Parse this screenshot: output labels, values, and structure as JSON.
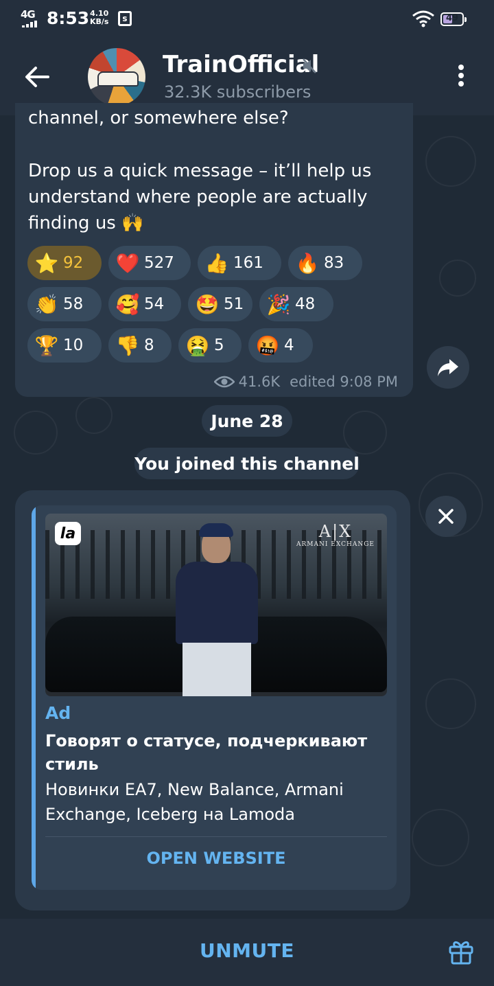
{
  "status_bar": {
    "network": "4G",
    "time": "8:53",
    "speed_value": "4.10",
    "speed_unit": "KB/s",
    "battery": "49",
    "battery_level": 0.49,
    "icons": [
      "signal-icon",
      "screenshot-app-icon",
      "wifi-icon",
      "battery-icon"
    ]
  },
  "header": {
    "title": "TrainOfficial",
    "subtitle": "32.3K subscribers",
    "icons": [
      "back-arrow-icon",
      "muted-speaker-icon",
      "more-vert-icon"
    ]
  },
  "message": {
    "text_cut": "channel, or somewhere else?",
    "text": "Drop us a quick message – it’ll help us\nunderstand where people are actually\nfinding us 🙌",
    "reactions": [
      {
        "emoji": "⭐",
        "count": "92",
        "active": true
      },
      {
        "emoji": "❤️",
        "count": "527"
      },
      {
        "emoji": "👍",
        "count": "161"
      },
      {
        "emoji": "🔥",
        "count": "83"
      },
      {
        "emoji": "👏",
        "count": "58"
      },
      {
        "emoji": "🥰",
        "count": "54"
      },
      {
        "emoji": "🤩",
        "count": "51"
      },
      {
        "emoji": "🎉",
        "count": "48"
      },
      {
        "emoji": "🏆",
        "count": "10"
      },
      {
        "emoji": "👎",
        "count": "8"
      },
      {
        "emoji": "🤮",
        "count": "5"
      },
      {
        "emoji": "🤬",
        "count": "4"
      }
    ],
    "views": "41.6K",
    "edited": "edited 9:08 PM"
  },
  "service": {
    "date": "June 28",
    "joined": "You joined this channel"
  },
  "ad": {
    "logo_text": "la",
    "brand_big": "A|X",
    "brand_small": "ARMANI EXCHANGE",
    "label": "Ad",
    "title": "Говорят о статусе, подчеркивают стиль",
    "description": "Новинки EA7, New Balance, Armani Exchange, Iceberg на Lamoda",
    "button": "OPEN WEBSITE"
  },
  "bottom": {
    "unmute": "UNMUTE",
    "gift_icon": "gift-icon"
  },
  "colors": {
    "accent": "#64b4f0",
    "bubble": "#2b3949",
    "header": "#242f3d",
    "reaction_active": "#6b5a2e",
    "reaction": "#374a5d"
  }
}
